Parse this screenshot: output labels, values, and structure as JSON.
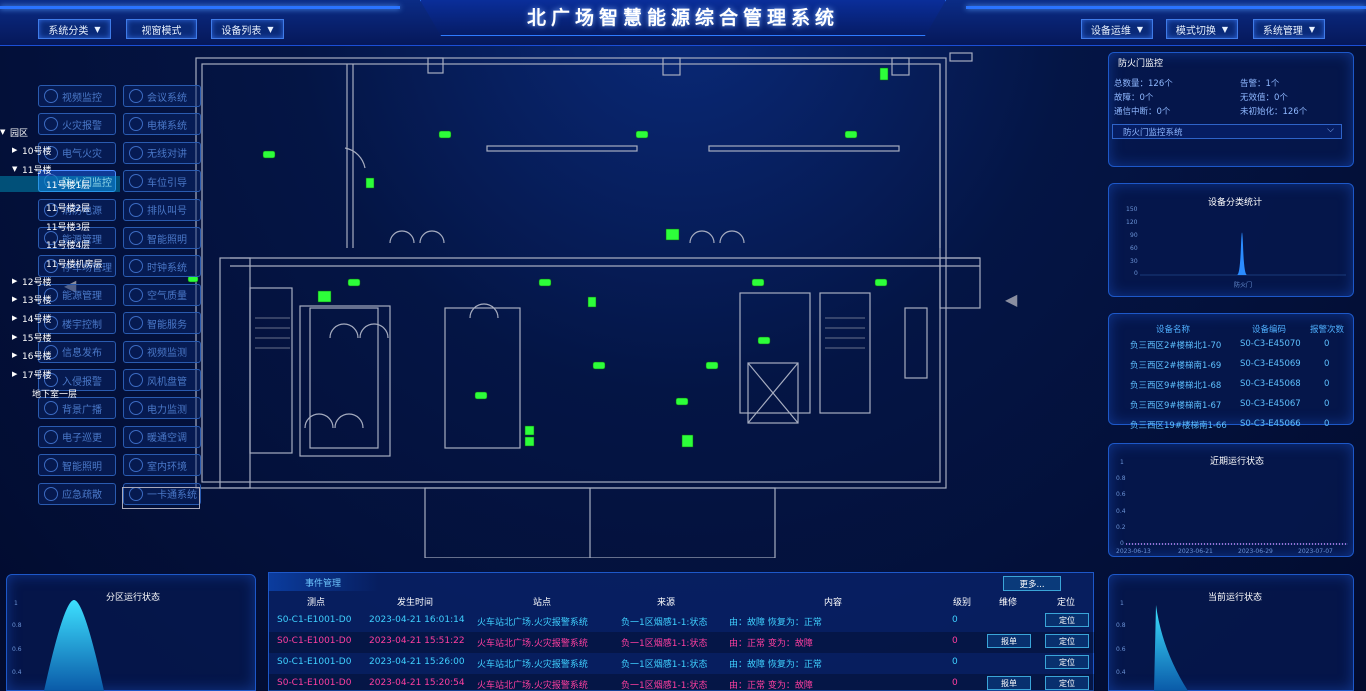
{
  "header": {
    "title": "北广场智慧能源综合管理系统",
    "left_buttons": [
      "系统分类",
      "视窗模式",
      "设备列表"
    ],
    "right_buttons": [
      "设备运维",
      "模式切换",
      "系统管理"
    ]
  },
  "menu": [
    "视频监控",
    "会议系统",
    "火灾报警",
    "电梯系统",
    "电气火灾",
    "无线对讲",
    "防火门监控",
    "车位引导",
    "消防电源",
    "排队叫号",
    "能源管理",
    "智能照明",
    "停车场管理",
    "时钟系统",
    "能源管理",
    "空气质量",
    "楼宇控制",
    "智能服务",
    "信息发布",
    "视频监测",
    "入侵报警",
    "风机盘管",
    "背景广播",
    "电力监测",
    "电子巡更",
    "暖通空调",
    "智能照明",
    "室内环境",
    "应急疏散",
    "一卡通系统"
  ],
  "tree": [
    {
      "label": "园区",
      "arrow": "▼"
    },
    {
      "label": "10号楼",
      "arrow": "▶"
    },
    {
      "label": "11号楼",
      "arrow": "▼"
    },
    {
      "label": "11号楼1层",
      "arrow": ""
    },
    {
      "label": "11号楼2层",
      "arrow": ""
    },
    {
      "label": "11号楼3层",
      "arrow": ""
    },
    {
      "label": "11号楼4层",
      "arrow": ""
    },
    {
      "label": "11号楼机房层",
      "arrow": ""
    },
    {
      "label": "12号楼",
      "arrow": "▶"
    },
    {
      "label": "13号楼",
      "arrow": "▶"
    },
    {
      "label": "14号楼",
      "arrow": "▶"
    },
    {
      "label": "15号楼",
      "arrow": "▶"
    },
    {
      "label": "16号楼",
      "arrow": "▶"
    },
    {
      "label": "17号楼",
      "arrow": "▶"
    },
    {
      "label": "地下室一层",
      "arrow": ""
    }
  ],
  "fire_door": {
    "title": "防火门监控",
    "total": "总数量：126个",
    "alarm": "告警：1个",
    "fault": "故障：0个",
    "invalid": "无效值：0个",
    "comm_break": "通信中断：0个",
    "uninit": "未初始化：126个",
    "select_value": "防火门监控系统"
  },
  "device_stats": {
    "title": "设备分类统计",
    "yticks": [
      "150",
      "120",
      "90",
      "60",
      "30",
      "0"
    ],
    "category": "防火门"
  },
  "device_table": {
    "headers": [
      "设备名称",
      "设备编码",
      "报警次数"
    ],
    "rows": [
      [
        "负三西区2#楼梯北1-70",
        "S0-C3-E45070",
        "0"
      ],
      [
        "负三西区2#楼梯南1-69",
        "S0-C3-E45069",
        "0"
      ],
      [
        "负三西区9#楼梯北1-68",
        "S0-C3-E45068",
        "0"
      ],
      [
        "负三西区9#楼梯南1-67",
        "S0-C3-E45067",
        "0"
      ],
      [
        "负三西区19#楼梯南1-66",
        "S0-C3-E45066",
        "0"
      ]
    ]
  },
  "recent_status": {
    "title": "近期运行状态",
    "yticks": [
      "1",
      "0.8",
      "0.6",
      "0.4",
      "0.2",
      "0"
    ],
    "xticks": [
      "2023-06-13",
      "2023-06-21",
      "2023-06-29",
      "2023-07-07"
    ]
  },
  "zone_status": {
    "title": "分区运行状态",
    "yticks": [
      "1",
      "0.8",
      "0.6",
      "0.4"
    ]
  },
  "current_status": {
    "title": "当前运行状态",
    "yticks": [
      "1",
      "0.8",
      "0.6",
      "0.4"
    ]
  },
  "events": {
    "tab": "事件管理",
    "more": "更多...",
    "headers": [
      "测点",
      "发生时间",
      "站点",
      "来源",
      "内容",
      "级别",
      "维修",
      "定位"
    ],
    "rows": [
      {
        "point": "S0-C1-E1001-D0",
        "time": "2023-04-21 16:01:14",
        "site": "火车站北广场.火灾报警系统",
        "source": "负一1区烟感1-1:状态",
        "content": "由：故障 恢复为：正常",
        "level": "0",
        "repair": "",
        "locate": "定位",
        "status": "ok"
      },
      {
        "point": "S0-C1-E1001-D0",
        "time": "2023-04-21 15:51:22",
        "site": "火车站北广场.火灾报警系统",
        "source": "负一1区烟感1-1:状态",
        "content": "由：正常 变为：故障",
        "level": "0",
        "repair": "报单",
        "locate": "定位",
        "status": "bad"
      },
      {
        "point": "S0-C1-E1001-D0",
        "time": "2023-04-21 15:26:00",
        "site": "火车站北广场.火灾报警系统",
        "source": "负一1区烟感1-1:状态",
        "content": "由：故障 恢复为：正常",
        "level": "0",
        "repair": "",
        "locate": "定位",
        "status": "ok"
      },
      {
        "point": "S0-C1-E1001-D0",
        "time": "2023-04-21 15:20:54",
        "site": "火车站北广场.火灾报警系统",
        "source": "负一1区烟感1-1:状态",
        "content": "由：正常 变为：故障",
        "level": "0",
        "repair": "报单",
        "locate": "定位",
        "status": "bad"
      }
    ]
  }
}
